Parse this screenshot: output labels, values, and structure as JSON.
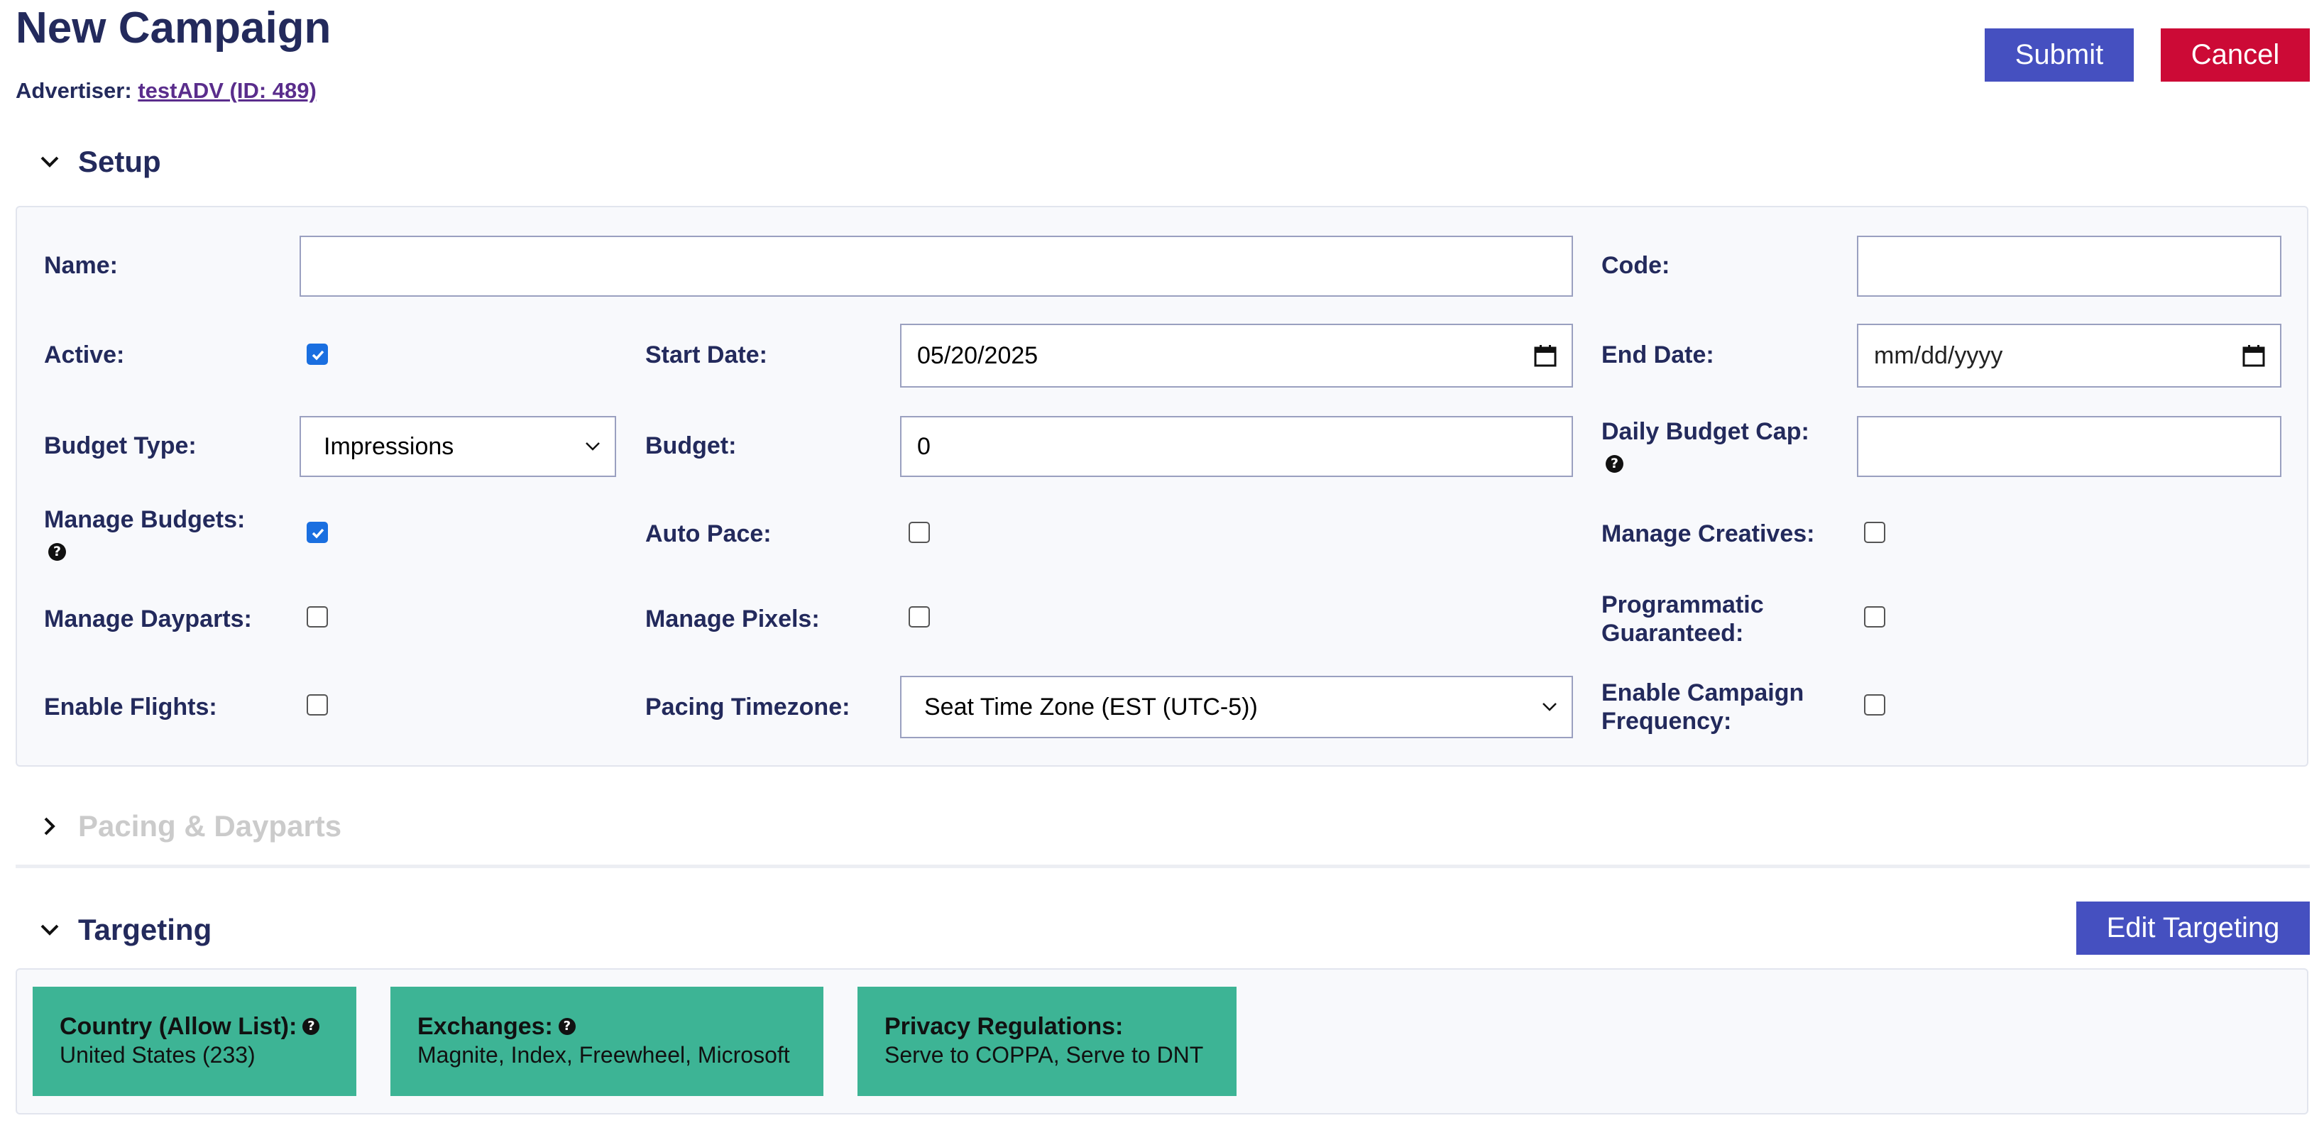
{
  "page": {
    "title": "New Campaign",
    "advertiser_label": "Advertiser:",
    "advertiser_link": "testADV (ID: 489)"
  },
  "actions": {
    "submit": "Submit",
    "cancel": "Cancel",
    "edit_targeting": "Edit Targeting"
  },
  "sections": {
    "setup": "Setup",
    "pacing": "Pacing & Dayparts",
    "targeting": "Targeting"
  },
  "setup": {
    "name": {
      "label": "Name:",
      "value": ""
    },
    "code": {
      "label": "Code:",
      "value": ""
    },
    "active": {
      "label": "Active:",
      "checked": true
    },
    "start_date": {
      "label": "Start Date:",
      "value": "05/20/2025"
    },
    "end_date": {
      "label": "End Date:",
      "placeholder": "mm/dd/yyyy"
    },
    "budget_type": {
      "label": "Budget Type:",
      "value": "Impressions"
    },
    "budget": {
      "label": "Budget:",
      "value": "0"
    },
    "daily_budget_cap": {
      "label": "Daily Budget Cap:",
      "value": ""
    },
    "manage_budgets": {
      "label": "Manage Budgets:",
      "checked": true
    },
    "auto_pace": {
      "label": "Auto Pace:",
      "checked": false
    },
    "manage_creatives": {
      "label": "Manage Creatives:",
      "checked": false
    },
    "manage_dayparts": {
      "label": "Manage Dayparts:",
      "checked": false
    },
    "manage_pixels": {
      "label": "Manage Pixels:",
      "checked": false
    },
    "programmatic_guaranteed": {
      "label_line1": "Programmatic",
      "label_line2": "Guaranteed:",
      "checked": false
    },
    "enable_flights": {
      "label": "Enable Flights:",
      "checked": false
    },
    "pacing_timezone": {
      "label": "Pacing Timezone:",
      "value": "Seat Time Zone (EST (UTC-5))"
    },
    "enable_campaign_frequency": {
      "label_line1": "Enable Campaign",
      "label_line2": "Frequency:",
      "checked": false
    }
  },
  "targeting": {
    "cards": [
      {
        "title": "Country (Allow List):",
        "value": "United States (233)",
        "help": true
      },
      {
        "title": "Exchanges:",
        "value": "Magnite, Index, Freewheel, Microsoft",
        "help": true
      },
      {
        "title": "Privacy Regulations:",
        "value": "Serve to COPPA, Serve to DNT",
        "help": false
      }
    ]
  },
  "icons": {
    "help": "?",
    "chevron_down": "chevron-down-icon",
    "chevron_right": "chevron-right-icon",
    "calendar": "calendar-icon",
    "select_caret": "chevron-down-icon"
  },
  "colors": {
    "primary": "#4550c0",
    "danger": "#cc0a36",
    "heading": "#232a5c",
    "card": "#3db495",
    "checkbox_checked": "#1a6fe0"
  }
}
